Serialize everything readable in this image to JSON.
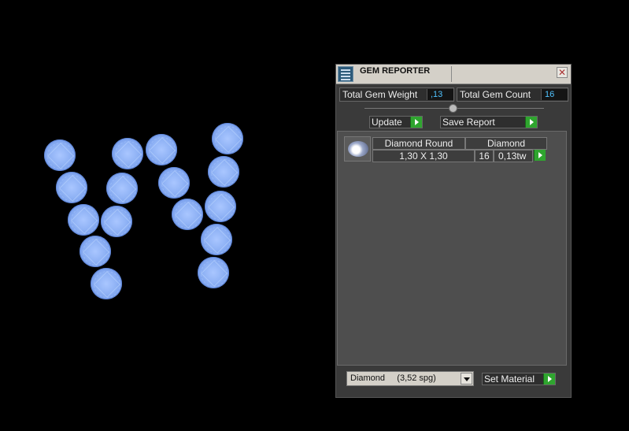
{
  "window": {
    "title": "GEM REPORTER",
    "close_glyph": "✕"
  },
  "stats": {
    "total_weight_label": "Total Gem Weight",
    "total_weight_value": ",13",
    "total_count_label": "Total Gem Count",
    "total_count_value": "16"
  },
  "actions": {
    "update_label": "Update",
    "save_report_label": "Save Report",
    "set_material_label": "Set Material"
  },
  "report": {
    "rows": [
      {
        "icon": "round-gem-thumbnail",
        "shape": "Diamond Round",
        "material": "Diamond",
        "size": "1,30 X 1,30",
        "count": "16",
        "weight": "0,13tw"
      }
    ]
  },
  "material_select": {
    "selected": "Diamond     (3,52 spg)"
  },
  "colors": {
    "gem_fill": "#8fb2f5",
    "value_text": "#4fc3ff",
    "go_button": "#2fa52f",
    "panel_bg": "#3a3a3a"
  },
  "icons": [
    "gem-reporter-icon",
    "close-icon",
    "go-arrow-icon",
    "dropdown-arrow-icon"
  ]
}
